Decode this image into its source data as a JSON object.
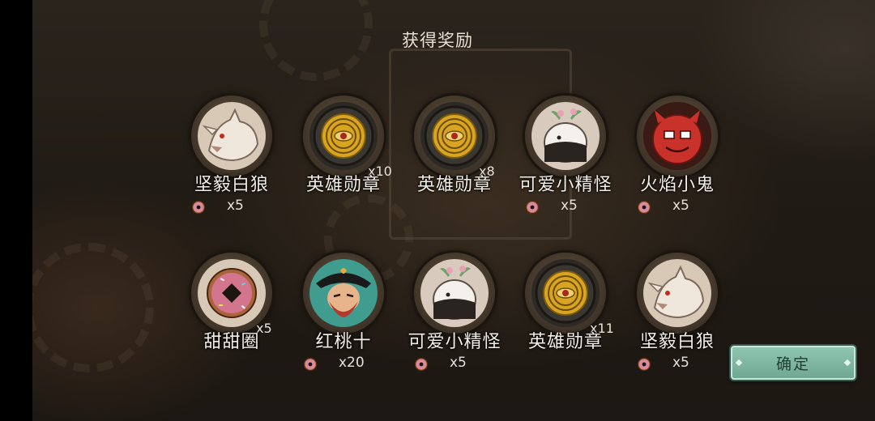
{
  "title": "获得奖励",
  "confirm_label": "确定",
  "rows": [
    [
      {
        "name": "坚毅白狼",
        "icon": "white-wolf-icon",
        "corner_qty": "",
        "cost": "x5"
      },
      {
        "name": "英雄勋章",
        "icon": "hero-medal-icon",
        "corner_qty": "x10",
        "cost": ""
      },
      {
        "name": "英雄勋章",
        "icon": "hero-medal-icon",
        "corner_qty": "x8",
        "cost": ""
      },
      {
        "name": "可爱小精怪",
        "icon": "cute-sprite-icon",
        "corner_qty": "",
        "cost": "x5"
      },
      {
        "name": "火焰小鬼",
        "icon": "fire-imp-icon",
        "corner_qty": "",
        "cost": "x5"
      }
    ],
    [
      {
        "name": "甜甜圈",
        "icon": "donut-icon",
        "corner_qty": "x5",
        "cost": ""
      },
      {
        "name": "红桃十",
        "icon": "ten-of-hearts-pirate-icon",
        "corner_qty": "",
        "cost": "x20"
      },
      {
        "name": "可爱小精怪",
        "icon": "cute-sprite-icon",
        "corner_qty": "",
        "cost": "x5"
      },
      {
        "name": "英雄勋章",
        "icon": "hero-medal-icon",
        "corner_qty": "x11",
        "cost": ""
      },
      {
        "name": "坚毅白狼",
        "icon": "white-wolf-icon",
        "corner_qty": "",
        "cost": "x5"
      }
    ]
  ]
}
